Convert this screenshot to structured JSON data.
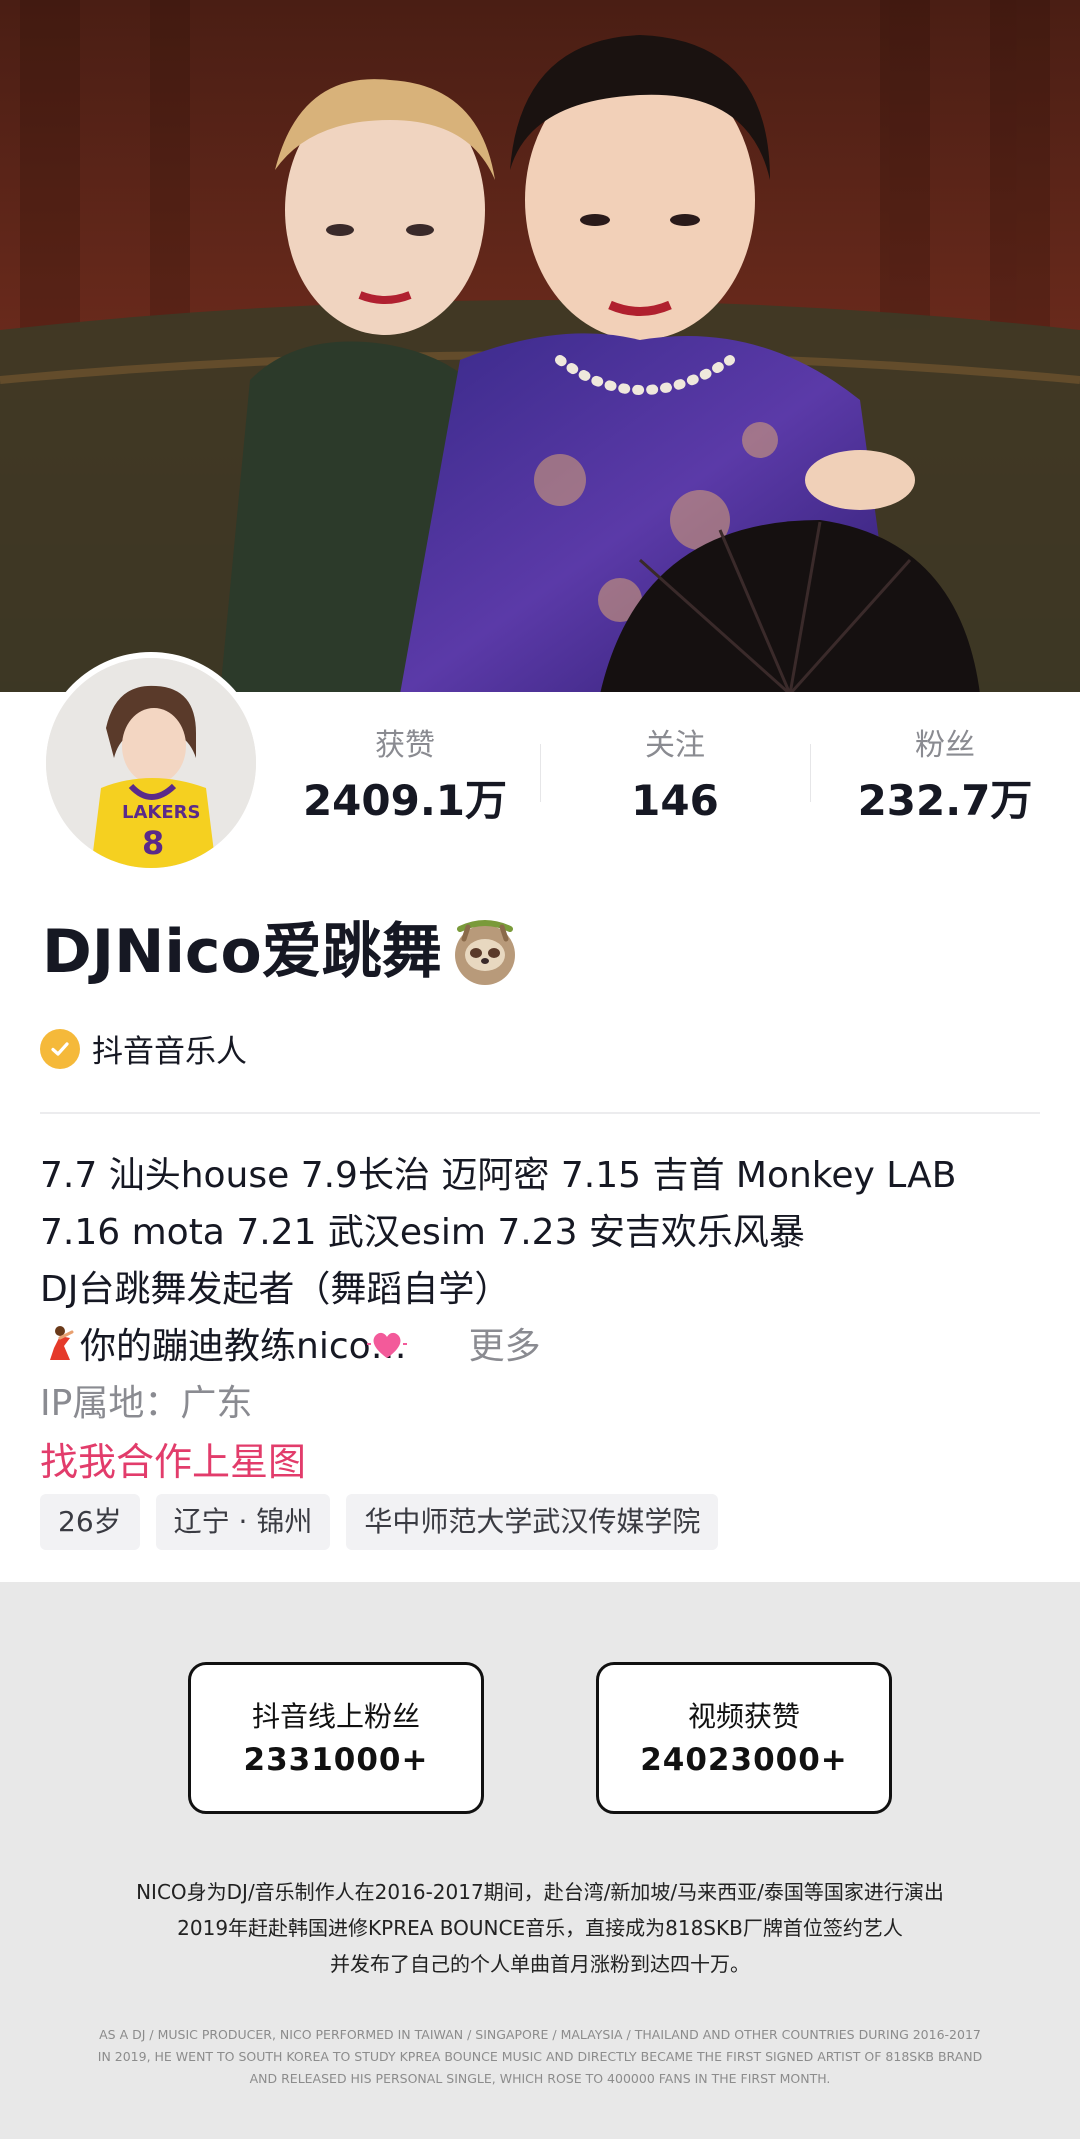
{
  "cover": {
    "description_icon": "cover-photo"
  },
  "profile": {
    "stats": [
      {
        "label": "获赞",
        "value": "2409.1万"
      },
      {
        "label": "关注",
        "value": "146"
      },
      {
        "label": "粉丝",
        "value": "232.7万"
      }
    ],
    "name": "DJNico爱跳舞",
    "name_emoji": "sloth-emoji",
    "verification": {
      "icon": "check-badge-icon",
      "text": "抖音音乐人",
      "color": "#f5b93a"
    },
    "bio": {
      "line1": "7.7 汕头house 7.9长治 迈阿密 7.15 吉首 Monkey LAB",
      "line2": "7.16 mota 7.21 武汉esim 7.23 安吉欢乐风暴",
      "line3": "DJ台跳舞发起者（舞蹈自学）",
      "line4": "你的蹦迪教练nico…",
      "line4_prefix_emoji": "dancer-emoji",
      "line4_suffix_emoji": "heart-emoji",
      "more": "更多"
    },
    "ip": "IP属地：广东",
    "star_link": "找我合作上星图",
    "tags": [
      "26岁",
      "辽宁 · 锦州",
      "华中师范大学武汉传媒学院"
    ]
  },
  "info": {
    "boxes": [
      {
        "label": "抖音线上粉丝",
        "value": "2331000+"
      },
      {
        "label": "视频获赞",
        "value": "24023000+"
      }
    ],
    "cn_lines": [
      "NICO身为DJ/音乐制作人在2016-2017期间，赴台湾/新加坡/马来西亚/泰国等国家进行演出",
      "2019年赶赴韩国进修KPREA BOUNCE音乐，直接成为818SKB厂牌首位签约艺人",
      "并发布了自己的个人单曲首月涨粉到达四十万。"
    ],
    "en_lines": [
      "AS A DJ / MUSIC PRODUCER, NICO PERFORMED IN TAIWAN / SINGAPORE / MALAYSIA / THAILAND AND OTHER COUNTRIES DURING 2016-2017",
      "IN 2019, HE WENT TO SOUTH KOREA TO STUDY KPREA BOUNCE MUSIC AND DIRECTLY BECAME THE FIRST SIGNED ARTIST OF 818SKB BRAND",
      "AND RELEASED HIS PERSONAL SINGLE, WHICH ROSE TO 400000 FANS IN THE FIRST MONTH."
    ]
  },
  "colors": {
    "accent_pink": "#e23c6b",
    "badge_gold": "#f5b93a",
    "muted": "#8a8b91"
  }
}
